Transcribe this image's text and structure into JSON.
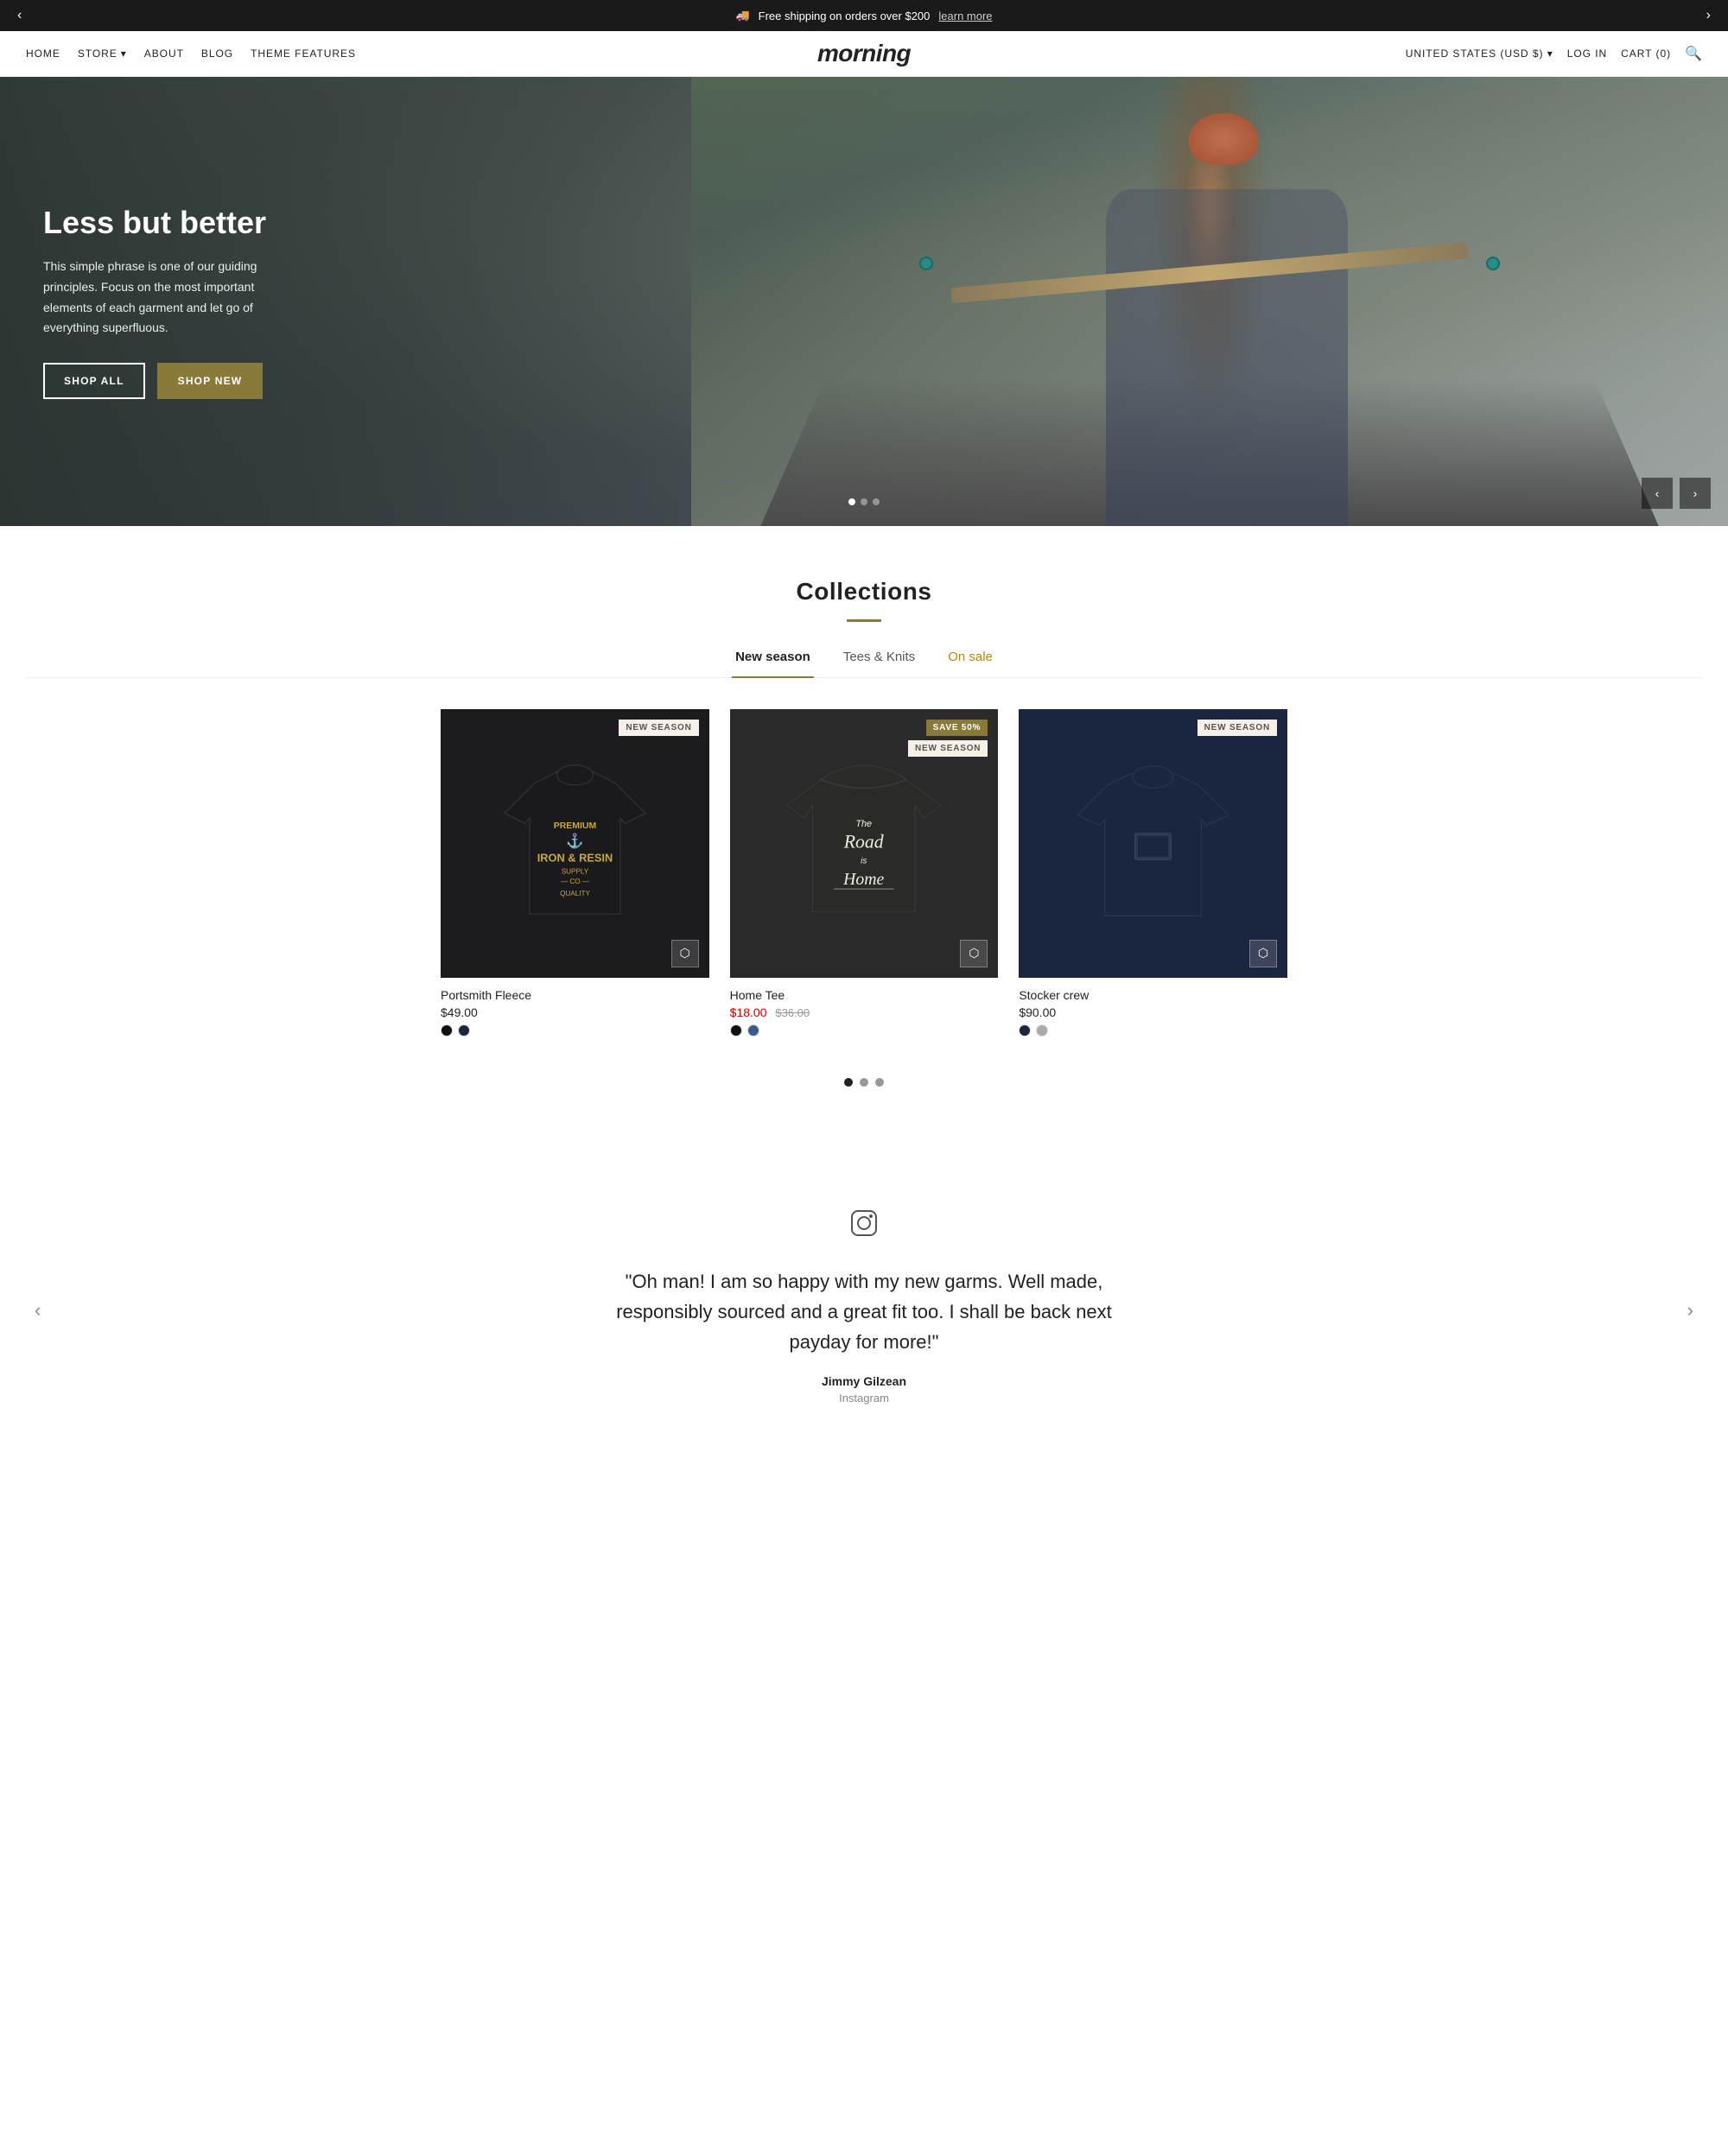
{
  "announcement": {
    "text": "Free shipping on orders over $200",
    "link_text": "learn more",
    "prev_icon": "‹",
    "next_icon": "›"
  },
  "header": {
    "logo": "morning",
    "nav_left": [
      {
        "label": "HOME",
        "id": "home"
      },
      {
        "label": "STORE",
        "id": "store",
        "has_dropdown": true
      },
      {
        "label": "ABOUT",
        "id": "about"
      },
      {
        "label": "BLOG",
        "id": "blog"
      },
      {
        "label": "THEME FEATURES",
        "id": "theme-features"
      }
    ],
    "nav_right": [
      {
        "label": "UNITED STATES (USD $)",
        "id": "currency"
      },
      {
        "label": "LOG IN",
        "id": "login"
      },
      {
        "label": "CART (0)",
        "id": "cart"
      }
    ]
  },
  "hero": {
    "title": "Less but better",
    "description": "This simple phrase is one of our guiding principles. Focus on the most important elements of each garment and let go of everything superfluous.",
    "btn_shop_all": "SHOP ALL",
    "btn_shop_new": "SHOP NEW",
    "prev_icon": "‹",
    "next_icon": "›",
    "dots": [
      true,
      false,
      false
    ]
  },
  "collections": {
    "title": "Collections",
    "tabs": [
      {
        "label": "New season",
        "active": true,
        "sale": false
      },
      {
        "label": "Tees & Knits",
        "active": false,
        "sale": false
      },
      {
        "label": "On sale",
        "active": false,
        "sale": true
      }
    ],
    "products": [
      {
        "name": "Portsmith Fleece",
        "price": "$49.00",
        "sale_price": null,
        "original_price": null,
        "badge": "NEW SEASON",
        "badge_type": "new",
        "bg": "dark",
        "swatches": [
          "black",
          "navy"
        ],
        "type": "sweater-iron"
      },
      {
        "name": "Home Tee",
        "price": "$18.00",
        "sale_price": "$18.00",
        "original_price": "$36.00",
        "badge": "SAVE 50%",
        "badge_secondary": "NEW SEASON",
        "badge_type": "save",
        "bg": "charcoal",
        "swatches": [
          "black",
          "blue"
        ],
        "type": "tshirt"
      },
      {
        "name": "Stocker crew",
        "price": "$90.00",
        "sale_price": null,
        "original_price": null,
        "badge": "NEW SEASON",
        "badge_type": "new",
        "bg": "navy",
        "swatches": [
          "navy",
          "gray"
        ],
        "type": "sweater-plain"
      }
    ],
    "pagination": [
      true,
      false,
      false
    ]
  },
  "testimonial": {
    "instagram_label": "instagram-icon",
    "quote": "\"Oh man! I am so happy with my new garms. Well made, responsibly sourced and a great fit too. I shall be back next payday for more!\"",
    "author": "Jimmy Gilzean",
    "source": "Instagram",
    "prev_icon": "‹",
    "next_icon": "›"
  }
}
